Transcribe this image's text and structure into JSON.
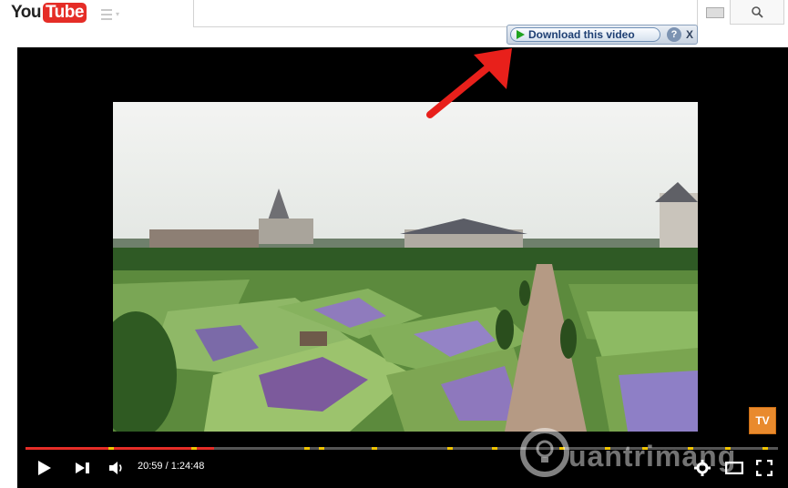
{
  "header": {
    "logo_you": "You",
    "logo_tube": "Tube",
    "guide_icon": "menu-icon",
    "search_value": "",
    "keyboard_icon": "keyboard-icon",
    "search_icon": "search-icon"
  },
  "download_bar": {
    "label": "Download this video",
    "help": "?",
    "close": "X"
  },
  "player": {
    "time": "20:59 / 1:24:48",
    "progress": 0.25,
    "chapter_markers": [
      0.11,
      0.22,
      0.37,
      0.39,
      0.46,
      0.56,
      0.62,
      0.71,
      0.77,
      0.82,
      0.88,
      0.93,
      0.98
    ],
    "icons": [
      "play-icon",
      "next-icon",
      "volume-icon",
      "settings-icon",
      "theater-icon",
      "fullscreen-icon"
    ]
  },
  "channel_badge": "TV",
  "watermark": {
    "text": "uantrimang"
  },
  "colors": {
    "accent": "#e52d27",
    "marker": "#f0c400"
  }
}
